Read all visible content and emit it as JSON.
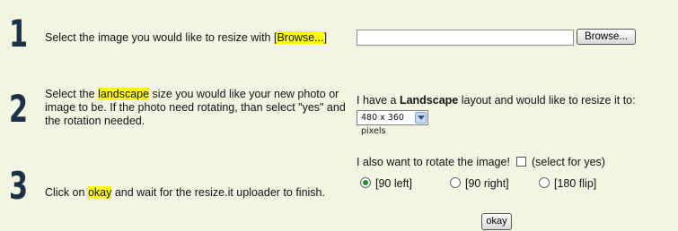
{
  "steps": [
    {
      "number": "1",
      "text_pre": "Select the image you would like to resize with [",
      "text_highlight": "Browse...",
      "text_post": "]"
    },
    {
      "number": "2",
      "text_pre": "Select the ",
      "text_highlight": "landscape",
      "text_post": " size you would like your new photo or image to be. If the photo need rotating, than select \"yes\" and the rotation needed."
    },
    {
      "number": "3",
      "text_pre": "Click on ",
      "text_highlight": "okay",
      "text_post": " and wait for the resize.it uploader to finish."
    }
  ],
  "upload": {
    "file_value": "",
    "browse_label": "Browse..."
  },
  "size": {
    "label_pre": "I have a ",
    "label_bold": "Landscape",
    "label_post": " layout and would like to resize it to:",
    "selected": "480 x 360 pixels"
  },
  "rotate": {
    "label": "I also want to rotate the image!",
    "checkbox_note": "(select for yes)",
    "checked": false,
    "options": [
      {
        "label": "[90 left]",
        "checked": true
      },
      {
        "label": "[90 right]",
        "checked": false
      },
      {
        "label": "[180 flip]",
        "checked": false
      }
    ]
  },
  "submit": {
    "label": "okay"
  }
}
